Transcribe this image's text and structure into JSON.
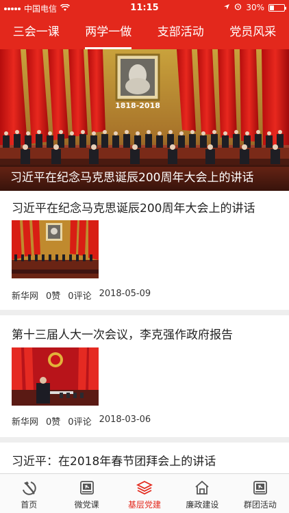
{
  "status_bar": {
    "carrier": "中国电信",
    "time": "11:15",
    "battery": "30%",
    "battery_level": 0.3
  },
  "tabs": [
    {
      "label": "三会一课"
    },
    {
      "label": "两学一做"
    },
    {
      "label": "支部活动"
    },
    {
      "label": "党员风采"
    }
  ],
  "active_tab": 1,
  "hero": {
    "banner_years": "1818-2018",
    "caption": "习近平在纪念马克思诞辰200周年大会上的讲话"
  },
  "articles": [
    {
      "title": "习近平在纪念马克思诞辰200周年大会上的讲话",
      "source": "新华网",
      "likes": "0赞",
      "comments": "0评论",
      "date": "2018-05-09"
    },
    {
      "title": "第十三届人大一次会议，李克强作政府报告",
      "source": "新华网",
      "likes": "0赞",
      "comments": "0评论",
      "date": "2018-03-06"
    },
    {
      "title": "习近平：在2018年春节团拜会上的讲话"
    }
  ],
  "bottom_nav": [
    {
      "label": "首页",
      "icon": "hammer-sickle-icon"
    },
    {
      "label": "微党课",
      "icon": "book-icon"
    },
    {
      "label": "基层党建",
      "icon": "layers-icon"
    },
    {
      "label": "廉政建设",
      "icon": "house-icon"
    },
    {
      "label": "群团活动",
      "icon": "book-icon"
    }
  ],
  "active_nav": 2,
  "colors": {
    "accent": "#e3281c",
    "separator": "#eeeeee"
  }
}
